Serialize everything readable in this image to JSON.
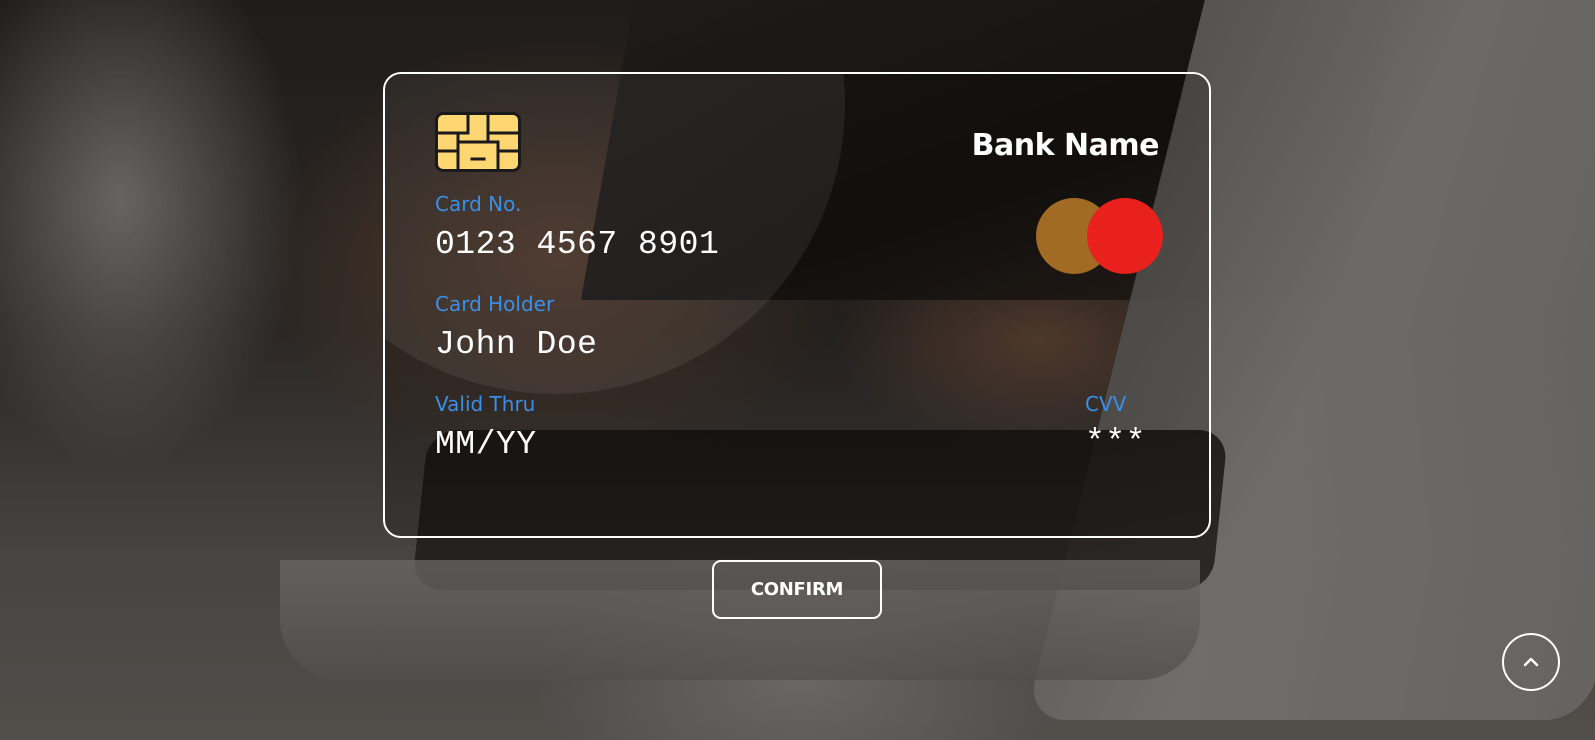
{
  "card": {
    "bank_name": "Bank Name",
    "card_no_label": "Card No.",
    "card_no_value": "0123 4567 8901",
    "holder_label": "Card Holder",
    "holder_value": "John Doe",
    "valid_label": "Valid Thru",
    "valid_value": "MM/YY",
    "cvv_label": "CVV",
    "cvv_value": "***",
    "chip_icon": "card-chip-icon",
    "network_logo": "mastercard-logo",
    "colors": {
      "label": "#3a8fe8",
      "chip": "#ffd772",
      "logo_left": "#a16b24",
      "logo_right": "#e8211c"
    }
  },
  "actions": {
    "confirm_label": "CONFIRM",
    "scroll_top_icon": "chevron-up-icon"
  }
}
